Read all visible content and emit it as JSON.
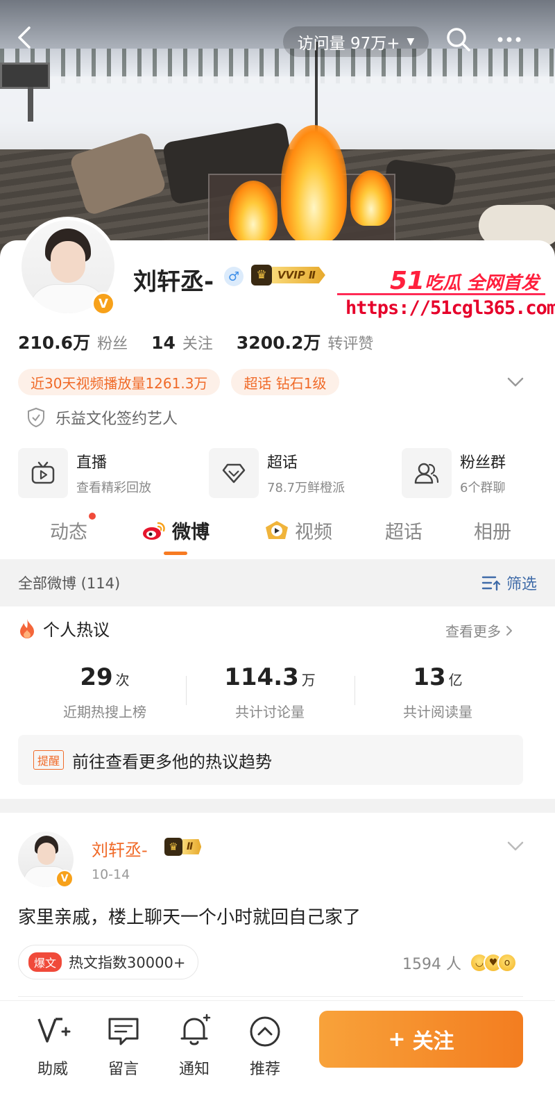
{
  "header": {
    "visit_label": "访问量 97万+",
    "caret": "▼"
  },
  "watermark": {
    "title_num": "51",
    "title_text": "吃瓜 全网首发",
    "url": "https://51cgl365.com"
  },
  "profile": {
    "name": "刘轩丞-",
    "gender_symbol": "♂",
    "vip_label": "VVIP Ⅱ",
    "verified_symbol": "V",
    "stats": [
      {
        "num": "210.6万",
        "label": "粉丝"
      },
      {
        "num": "14",
        "label": "关注"
      },
      {
        "num": "3200.2万",
        "label": "转评赞"
      }
    ],
    "tags": [
      "近30天视频播放量1261.3万",
      "超话 钻石1级"
    ],
    "signed": "乐益文化签约艺人"
  },
  "features": [
    {
      "title": "直播",
      "sub": "查看精彩回放",
      "icon": "tv-icon"
    },
    {
      "title": "超话",
      "sub": "78.7万鲜橙派",
      "icon": "diamond-icon"
    },
    {
      "title": "粉丝群",
      "sub": "6个群聊",
      "icon": "group-icon"
    }
  ],
  "tabs": [
    "动态",
    "微博",
    "视频",
    "超话",
    "相册"
  ],
  "active_tab": "微博",
  "filter_bar": {
    "label": "全部微博 (114)",
    "filter_label": "筛选"
  },
  "hot": {
    "title": "个人热议",
    "more": "查看更多",
    "metrics": [
      {
        "value": "29",
        "unit": "次",
        "desc": "近期热搜上榜"
      },
      {
        "value": "114.3",
        "unit": "万",
        "desc": "共计讨论量"
      },
      {
        "value": "13",
        "unit": "亿",
        "desc": "共计阅读量"
      }
    ],
    "remind_badge": "提醒",
    "remind_text": "前往查看更多他的热议趋势"
  },
  "post": {
    "author": "刘轩丞-",
    "vip_label": "Ⅱ",
    "date": "10-14",
    "text": "家里亲戚，楼上聊天一个小时就回自己家了",
    "badge": "爆文",
    "hot_index": "热文指数30000+",
    "likes": "1594 人"
  },
  "bottom_bar": {
    "items": [
      {
        "label": "助威",
        "icon": "cheer-icon"
      },
      {
        "label": "留言",
        "icon": "comment-icon"
      },
      {
        "label": "通知",
        "icon": "bell-icon"
      },
      {
        "label": "推荐",
        "icon": "recommend-icon"
      }
    ],
    "follow": "关注",
    "follow_plus": "+"
  },
  "colors": {
    "accent": "#f77b22",
    "follow_button": "#f48a2c",
    "tag_text": "#f06a28",
    "filter_blue": "#3f6ba8"
  }
}
